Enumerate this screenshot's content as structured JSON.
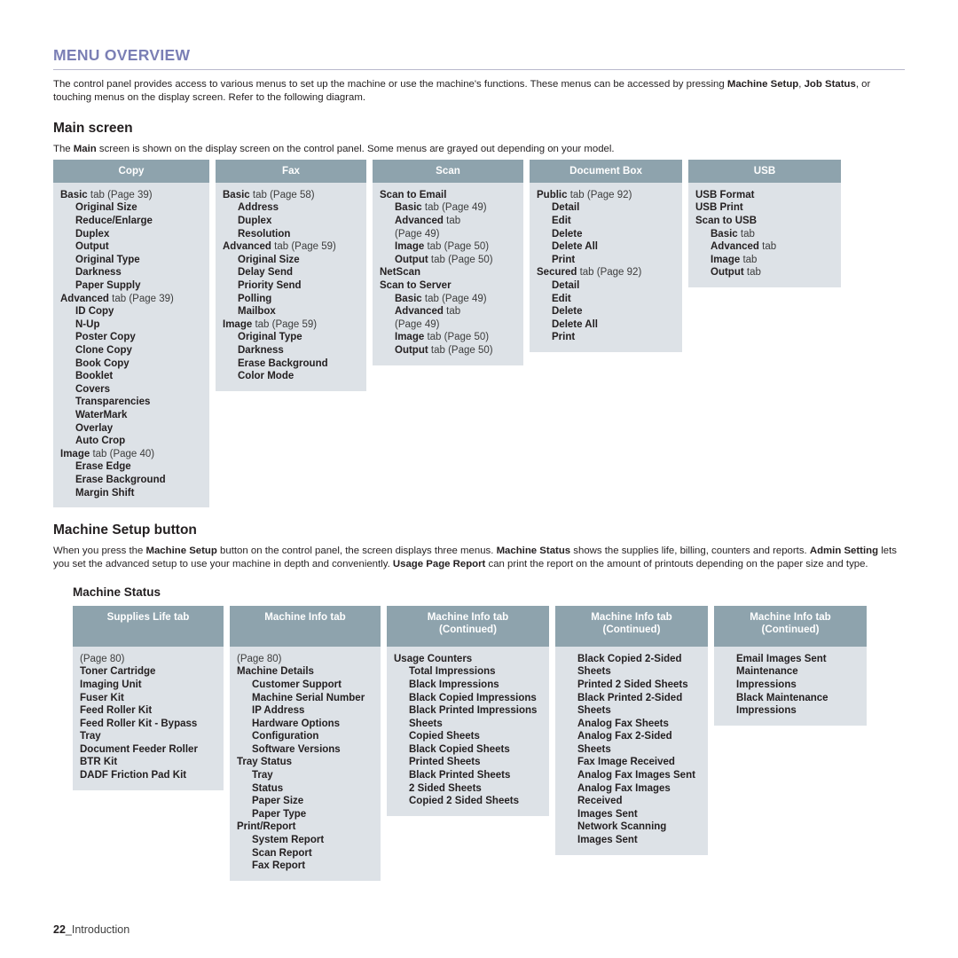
{
  "page": {
    "section_title": "MENU OVERVIEW",
    "intro_parts": [
      {
        "text": "The control panel provides access to various menus to set up the machine or use the machine's functions. These menus can be accessed by pressing ",
        "bold": false
      },
      {
        "text": "Machine Setup",
        "bold": true
      },
      {
        "text": ", ",
        "bold": false
      },
      {
        "text": "Job Status",
        "bold": true
      },
      {
        "text": ", or touching menus on the display screen. Refer to the following diagram.",
        "bold": false
      }
    ],
    "main_screen": {
      "heading": "Main screen",
      "intro_parts": [
        {
          "text": "The ",
          "bold": false
        },
        {
          "text": "Main",
          "bold": true
        },
        {
          "text": " screen is shown on the display screen on the control panel. Some menus are grayed out depending on your model.",
          "bold": false
        }
      ],
      "columns": [
        {
          "header": "Copy",
          "header_cont": "",
          "entries": [
            {
              "level": 0,
              "bold_text": "Basic",
              "plain_text": " tab (Page 39)"
            },
            {
              "level": 1,
              "bold_text": "Original Size",
              "plain_text": ""
            },
            {
              "level": 1,
              "bold_text": "Reduce/Enlarge",
              "plain_text": ""
            },
            {
              "level": 1,
              "bold_text": "Duplex",
              "plain_text": ""
            },
            {
              "level": 1,
              "bold_text": "Output",
              "plain_text": ""
            },
            {
              "level": 1,
              "bold_text": "Original Type",
              "plain_text": ""
            },
            {
              "level": 1,
              "bold_text": "Darkness",
              "plain_text": ""
            },
            {
              "level": 1,
              "bold_text": "Paper Supply",
              "plain_text": ""
            },
            {
              "level": 0,
              "bold_text": "Advanced",
              "plain_text": " tab (Page 39)"
            },
            {
              "level": 1,
              "bold_text": "ID Copy",
              "plain_text": ""
            },
            {
              "level": 1,
              "bold_text": "N-Up",
              "plain_text": ""
            },
            {
              "level": 1,
              "bold_text": "Poster Copy",
              "plain_text": ""
            },
            {
              "level": 1,
              "bold_text": "Clone Copy",
              "plain_text": ""
            },
            {
              "level": 1,
              "bold_text": "Book Copy",
              "plain_text": ""
            },
            {
              "level": 1,
              "bold_text": "Booklet",
              "plain_text": ""
            },
            {
              "level": 1,
              "bold_text": "Covers",
              "plain_text": ""
            },
            {
              "level": 1,
              "bold_text": "Transparencies",
              "plain_text": ""
            },
            {
              "level": 1,
              "bold_text": "WaterMark",
              "plain_text": ""
            },
            {
              "level": 1,
              "bold_text": "Overlay",
              "plain_text": ""
            },
            {
              "level": 1,
              "bold_text": "Auto Crop",
              "plain_text": ""
            },
            {
              "level": 0,
              "bold_text": "Image",
              "plain_text": " tab (Page 40)"
            },
            {
              "level": 1,
              "bold_text": "Erase Edge",
              "plain_text": ""
            },
            {
              "level": 1,
              "bold_text": "Erase Background",
              "plain_text": ""
            },
            {
              "level": 1,
              "bold_text": "Margin Shift",
              "plain_text": ""
            }
          ]
        },
        {
          "header": "Fax",
          "header_cont": "",
          "entries": [
            {
              "level": 0,
              "bold_text": "Basic",
              "plain_text": " tab (Page 58)"
            },
            {
              "level": 1,
              "bold_text": "Address",
              "plain_text": ""
            },
            {
              "level": 1,
              "bold_text": "Duplex",
              "plain_text": ""
            },
            {
              "level": 1,
              "bold_text": "Resolution",
              "plain_text": ""
            },
            {
              "level": 0,
              "bold_text": "Advanced",
              "plain_text": " tab (Page 59)"
            },
            {
              "level": 1,
              "bold_text": "Original Size",
              "plain_text": ""
            },
            {
              "level": 1,
              "bold_text": "Delay Send",
              "plain_text": ""
            },
            {
              "level": 1,
              "bold_text": "Priority Send",
              "plain_text": ""
            },
            {
              "level": 1,
              "bold_text": "Polling",
              "plain_text": ""
            },
            {
              "level": 1,
              "bold_text": "Mailbox",
              "plain_text": ""
            },
            {
              "level": 0,
              "bold_text": "Image",
              "plain_text": " tab (Page 59)"
            },
            {
              "level": 1,
              "bold_text": "Original Type",
              "plain_text": ""
            },
            {
              "level": 1,
              "bold_text": "Darkness",
              "plain_text": ""
            },
            {
              "level": 1,
              "bold_text": "Erase Background",
              "plain_text": ""
            },
            {
              "level": 1,
              "bold_text": "Color Mode",
              "plain_text": ""
            }
          ]
        },
        {
          "header": "Scan",
          "header_cont": "",
          "entries": [
            {
              "level": 0,
              "bold_text": "Scan to Email",
              "plain_text": ""
            },
            {
              "level": 1,
              "bold_text": "Basic",
              "plain_text": " tab (Page 49)"
            },
            {
              "level": 1,
              "bold_text": "Advanced",
              "plain_text": " tab"
            },
            {
              "level": 1,
              "bold_text": "",
              "plain_text": "(Page 49)"
            },
            {
              "level": 1,
              "bold_text": "Image",
              "plain_text": " tab (Page 50)"
            },
            {
              "level": 1,
              "bold_text": "Output",
              "plain_text": " tab (Page 50)"
            },
            {
              "level": 0,
              "bold_text": "NetScan",
              "plain_text": ""
            },
            {
              "level": 0,
              "bold_text": "Scan to Server",
              "plain_text": ""
            },
            {
              "level": 1,
              "bold_text": "Basic",
              "plain_text": " tab (Page 49)"
            },
            {
              "level": 1,
              "bold_text": "Advanced",
              "plain_text": " tab"
            },
            {
              "level": 1,
              "bold_text": "",
              "plain_text": "(Page 49)"
            },
            {
              "level": 1,
              "bold_text": "Image",
              "plain_text": " tab (Page 50)"
            },
            {
              "level": 1,
              "bold_text": "Output",
              "plain_text": " tab (Page 50)"
            }
          ]
        },
        {
          "header": "Document Box",
          "header_cont": "",
          "entries": [
            {
              "level": 0,
              "bold_text": "Public",
              "plain_text": " tab (Page 92)"
            },
            {
              "level": 1,
              "bold_text": "Detail",
              "plain_text": ""
            },
            {
              "level": 1,
              "bold_text": "Edit",
              "plain_text": ""
            },
            {
              "level": 1,
              "bold_text": "Delete",
              "plain_text": ""
            },
            {
              "level": 1,
              "bold_text": "Delete All",
              "plain_text": ""
            },
            {
              "level": 1,
              "bold_text": "Print",
              "plain_text": ""
            },
            {
              "level": 0,
              "bold_text": "Secured",
              "plain_text": " tab (Page 92)"
            },
            {
              "level": 1,
              "bold_text": "Detail",
              "plain_text": ""
            },
            {
              "level": 1,
              "bold_text": "Edit",
              "plain_text": ""
            },
            {
              "level": 1,
              "bold_text": "Delete",
              "plain_text": ""
            },
            {
              "level": 1,
              "bold_text": "Delete All",
              "plain_text": ""
            },
            {
              "level": 1,
              "bold_text": "Print",
              "plain_text": ""
            }
          ]
        },
        {
          "header": "USB",
          "header_cont": "",
          "entries": [
            {
              "level": 0,
              "bold_text": "USB Format",
              "plain_text": ""
            },
            {
              "level": 0,
              "bold_text": "USB Print",
              "plain_text": ""
            },
            {
              "level": 0,
              "bold_text": "Scan to USB",
              "plain_text": ""
            },
            {
              "level": 1,
              "bold_text": "Basic",
              "plain_text": " tab"
            },
            {
              "level": 1,
              "bold_text": "Advanced",
              "plain_text": " tab"
            },
            {
              "level": 1,
              "bold_text": "Image",
              "plain_text": " tab"
            },
            {
              "level": 1,
              "bold_text": "Output",
              "plain_text": " tab"
            }
          ]
        }
      ]
    },
    "machine_setup": {
      "heading": "Machine Setup button",
      "intro_parts": [
        {
          "text": "When you press the ",
          "bold": false
        },
        {
          "text": "Machine Setup",
          "bold": true
        },
        {
          "text": " button on the control panel, the screen displays three menus. ",
          "bold": false
        },
        {
          "text": "Machine Status",
          "bold": true
        },
        {
          "text": " shows the supplies life, billing, counters and reports. ",
          "bold": false
        },
        {
          "text": "Admin Setting",
          "bold": true
        },
        {
          "text": " lets you set the advanced setup to use your machine in depth and conveniently. ",
          "bold": false
        },
        {
          "text": "Usage Page Report",
          "bold": true
        },
        {
          "text": " can print the report on the amount of printouts depending on the paper size and type.",
          "bold": false
        }
      ],
      "machine_status_heading": "Machine Status",
      "columns": [
        {
          "header": "Supplies Life tab",
          "header_cont": "",
          "entries": [
            {
              "level": 0,
              "bold_text": "",
              "plain_text": "(Page 80)"
            },
            {
              "level": 0,
              "bold_text": "Toner Cartridge",
              "plain_text": ""
            },
            {
              "level": 0,
              "bold_text": "Imaging Unit",
              "plain_text": ""
            },
            {
              "level": 0,
              "bold_text": "Fuser Kit",
              "plain_text": ""
            },
            {
              "level": 0,
              "bold_text": "Feed Roller Kit",
              "plain_text": ""
            },
            {
              "level": 0,
              "bold_text": "Feed Roller Kit - Bypass Tray",
              "plain_text": ""
            },
            {
              "level": 0,
              "bold_text": "Document Feeder Roller",
              "plain_text": ""
            },
            {
              "level": 0,
              "bold_text": "BTR Kit",
              "plain_text": ""
            },
            {
              "level": 0,
              "bold_text": "DADF Friction Pad Kit",
              "plain_text": ""
            }
          ]
        },
        {
          "header": "Machine Info tab",
          "header_cont": "",
          "entries": [
            {
              "level": 0,
              "bold_text": "",
              "plain_text": "(Page 80)"
            },
            {
              "level": 0,
              "bold_text": "Machine Details",
              "plain_text": ""
            },
            {
              "level": 1,
              "bold_text": "Customer Support",
              "plain_text": ""
            },
            {
              "level": 1,
              "bold_text": "Machine Serial Number",
              "plain_text": ""
            },
            {
              "level": 1,
              "bold_text": "IP Address",
              "plain_text": ""
            },
            {
              "level": 1,
              "bold_text": "Hardware Options",
              "plain_text": ""
            },
            {
              "level": 1,
              "bold_text": "Configuration",
              "plain_text": ""
            },
            {
              "level": 1,
              "bold_text": "Software Versions",
              "plain_text": ""
            },
            {
              "level": 0,
              "bold_text": "Tray Status",
              "plain_text": ""
            },
            {
              "level": 1,
              "bold_text": "Tray",
              "plain_text": ""
            },
            {
              "level": 1,
              "bold_text": "Status",
              "plain_text": ""
            },
            {
              "level": 1,
              "bold_text": "Paper Size",
              "plain_text": ""
            },
            {
              "level": 1,
              "bold_text": "Paper Type",
              "plain_text": ""
            },
            {
              "level": 0,
              "bold_text": "Print/Report",
              "plain_text": ""
            },
            {
              "level": 1,
              "bold_text": "System Report",
              "plain_text": ""
            },
            {
              "level": 1,
              "bold_text": "Scan Report",
              "plain_text": ""
            },
            {
              "level": 1,
              "bold_text": "Fax Report",
              "plain_text": ""
            }
          ]
        },
        {
          "header": "Machine Info tab",
          "header_cont": "(Continued)",
          "entries": [
            {
              "level": 0,
              "bold_text": "Usage Counters",
              "plain_text": ""
            },
            {
              "level": 1,
              "bold_text": "Total Impressions",
              "plain_text": ""
            },
            {
              "level": 1,
              "bold_text": "Black Impressions",
              "plain_text": ""
            },
            {
              "level": 1,
              "bold_text": "Black Copied Impressions",
              "plain_text": ""
            },
            {
              "level": 1,
              "bold_text": "Black Printed Impressions",
              "plain_text": ""
            },
            {
              "level": 1,
              "bold_text": "Sheets",
              "plain_text": ""
            },
            {
              "level": 1,
              "bold_text": "Copied Sheets",
              "plain_text": ""
            },
            {
              "level": 1,
              "bold_text": "Black Copied Sheets",
              "plain_text": ""
            },
            {
              "level": 1,
              "bold_text": "Printed Sheets",
              "plain_text": ""
            },
            {
              "level": 1,
              "bold_text": "Black Printed Sheets",
              "plain_text": ""
            },
            {
              "level": 1,
              "bold_text": "2 Sided Sheets",
              "plain_text": ""
            },
            {
              "level": 1,
              "bold_text": "Copied 2 Sided Sheets",
              "plain_text": ""
            }
          ]
        },
        {
          "header": "Machine Info tab",
          "header_cont": "(Continued)",
          "entries": [
            {
              "level": 1,
              "bold_text": "Black Copied 2-Sided Sheets",
              "plain_text": ""
            },
            {
              "level": 1,
              "bold_text": "Printed 2 Sided Sheets",
              "plain_text": ""
            },
            {
              "level": 1,
              "bold_text": "Black Printed 2-Sided Sheets",
              "plain_text": ""
            },
            {
              "level": 1,
              "bold_text": "Analog Fax Sheets",
              "plain_text": ""
            },
            {
              "level": 1,
              "bold_text": "Analog Fax 2-Sided Sheets",
              "plain_text": ""
            },
            {
              "level": 1,
              "bold_text": "Fax Image Received",
              "plain_text": ""
            },
            {
              "level": 1,
              "bold_text": "Analog Fax Images Sent",
              "plain_text": ""
            },
            {
              "level": 1,
              "bold_text": "Analog Fax Images Received",
              "plain_text": ""
            },
            {
              "level": 1,
              "bold_text": "Images Sent",
              "plain_text": ""
            },
            {
              "level": 1,
              "bold_text": "Network Scanning Images Sent",
              "plain_text": ""
            }
          ]
        },
        {
          "header": "Machine Info tab",
          "header_cont": "(Continued)",
          "entries": [
            {
              "level": 1,
              "bold_text": "Email Images Sent",
              "plain_text": ""
            },
            {
              "level": 1,
              "bold_text": "Maintenance Impressions",
              "plain_text": ""
            },
            {
              "level": 1,
              "bold_text": "Black Maintenance Impressions",
              "plain_text": ""
            }
          ]
        }
      ]
    },
    "footer": {
      "page_number": "22",
      "chapter": "_Introduction"
    },
    "colors": {
      "title": "#7b7fb5",
      "header_bar": "#8ea3ad",
      "panel_bg": "#dde2e7",
      "text": "#231f20"
    }
  }
}
